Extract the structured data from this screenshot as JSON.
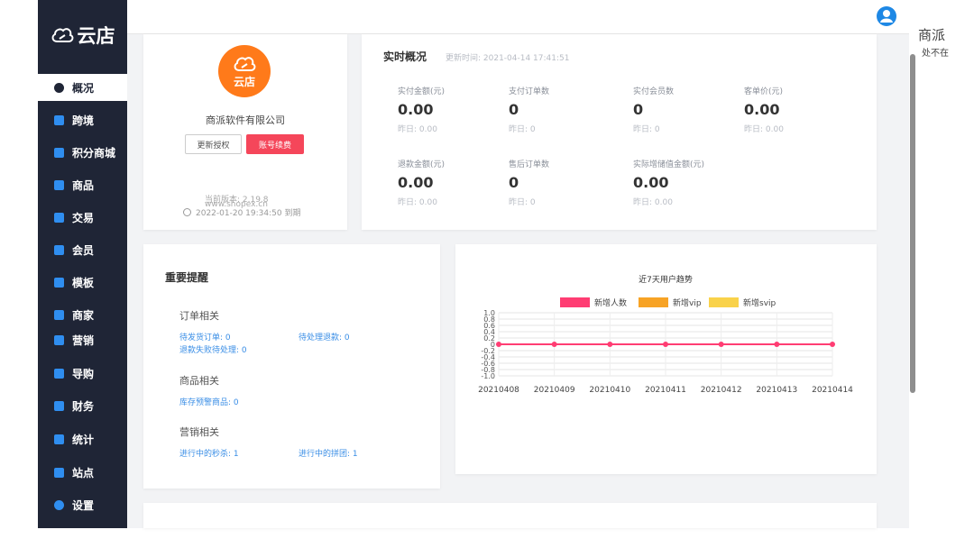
{
  "brand": {
    "name": "云店"
  },
  "nav": [
    {
      "label": "概况",
      "icon": "dashboard-icon",
      "active": true
    },
    {
      "label": "跨境",
      "icon": "globe-icon"
    },
    {
      "label": "积分商城",
      "icon": "points-mall-icon"
    },
    {
      "label": "商品",
      "icon": "bag-icon"
    },
    {
      "label": "交易",
      "icon": "trade-icon"
    },
    {
      "label": "会员",
      "icon": "diamond-icon"
    },
    {
      "label": "模板",
      "icon": "template-icon"
    },
    {
      "label": "商家",
      "icon": "store-icon"
    },
    {
      "label": "营销",
      "icon": "gift-icon"
    },
    {
      "label": "导购",
      "icon": "guide-icon"
    },
    {
      "label": "财务",
      "icon": "finance-icon"
    },
    {
      "label": "统计",
      "icon": "chart-icon"
    },
    {
      "label": "站点",
      "icon": "sitemap-icon"
    },
    {
      "label": "设置",
      "icon": "gear-icon"
    }
  ],
  "profile": {
    "logo_text": "云店",
    "company": "商派软件有限公司",
    "update_btn": "更新授权",
    "renew_btn": "账号续费",
    "version": "当前版本: 2.19.8",
    "website": "www.shopex.cn",
    "expiry": "2022-01-20 19:34:50 到期"
  },
  "realtime": {
    "title": "实时概况",
    "update_time": "更新时间: 2021-04-14 17:41:51",
    "metrics": [
      {
        "label": "实付金额(元)",
        "value": "0.00",
        "yesterday": "昨日: 0.00"
      },
      {
        "label": "支付订单数",
        "value": "0",
        "yesterday": "昨日: 0"
      },
      {
        "label": "实付会员数",
        "value": "0",
        "yesterday": "昨日: 0"
      },
      {
        "label": "客单价(元)",
        "value": "0.00",
        "yesterday": "昨日: 0.00"
      },
      {
        "label": "退款金额(元)",
        "value": "0.00",
        "yesterday": "昨日: 0.00"
      },
      {
        "label": "售后订单数",
        "value": "0",
        "yesterday": "昨日: 0"
      },
      {
        "label": "实际增储值金额(元)",
        "value": "0.00",
        "yesterday": "昨日: 0.00"
      }
    ]
  },
  "reminders": {
    "title": "重要提醒",
    "order_section": "订单相关",
    "pending_ship": "待发货订单: 0",
    "pending_refund": "待处理退款: 0",
    "refund_failed": "退款失败待处理: 0",
    "goods_section": "商品相关",
    "stock_warning": "库存预警商品: 0",
    "marketing_section": "营销相关",
    "flash_sale": "进行中的秒杀: 1",
    "group_buy": "进行中的拼团: 1"
  },
  "right_panel": {
    "title": "商派",
    "subtitle": "处不在"
  },
  "colors": {
    "sidebar": "#1f2536",
    "accent_orange": "#ff7a1a",
    "renew_red": "#f5465a",
    "link_blue": "#3a8ee6"
  },
  "chart_data": {
    "type": "line",
    "title": "近7天用户趋势",
    "categories": [
      "20210408",
      "20210409",
      "20210410",
      "20210411",
      "20210412",
      "20210413",
      "20210414"
    ],
    "series": [
      {
        "name": "新增人数",
        "color": "#ff3d73",
        "values": [
          0,
          0,
          0,
          0,
          0,
          0,
          0
        ]
      },
      {
        "name": "新增vip",
        "color": "#f7a325",
        "values": [
          0,
          0,
          0,
          0,
          0,
          0,
          0
        ]
      },
      {
        "name": "新增svip",
        "color": "#f9d24a",
        "values": [
          0,
          0,
          0,
          0,
          0,
          0,
          0
        ]
      }
    ],
    "yticks": [
      "1.0",
      "0.8",
      "0.6",
      "0.4",
      "0.2",
      "0",
      "-0.2",
      "-0.4",
      "-0.6",
      "-0.8",
      "-1.0"
    ],
    "ylim": [
      -1,
      1
    ],
    "legend": "top-center",
    "grid": true
  }
}
